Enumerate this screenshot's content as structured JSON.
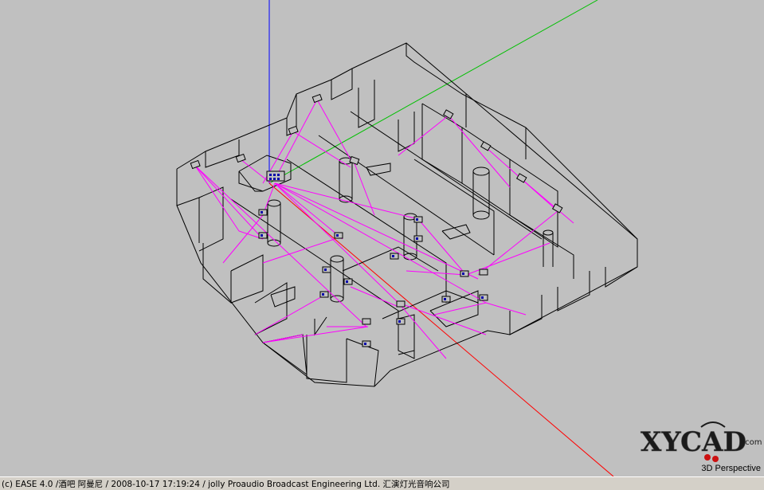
{
  "statusbar": {
    "text": "(c) EASE 4.0  /酒吧 阿曼尼 / 2008-10-17 17:19:24 / jolly Proaudio Broadcast Engineering Ltd. 汇演灯光音响公司"
  },
  "viewport": {
    "mode_label": "3D Perspective",
    "background": "#c0c0c0"
  },
  "logo": {
    "text": "XYCAD",
    "suffix": ".com"
  },
  "axes": {
    "x_color": "#ff0000",
    "y_color": "#00c000",
    "z_color": "#0000ff"
  },
  "colors": {
    "wireframe": "#000000",
    "rays": "#ff00ff",
    "speaker": "#0000aa"
  }
}
